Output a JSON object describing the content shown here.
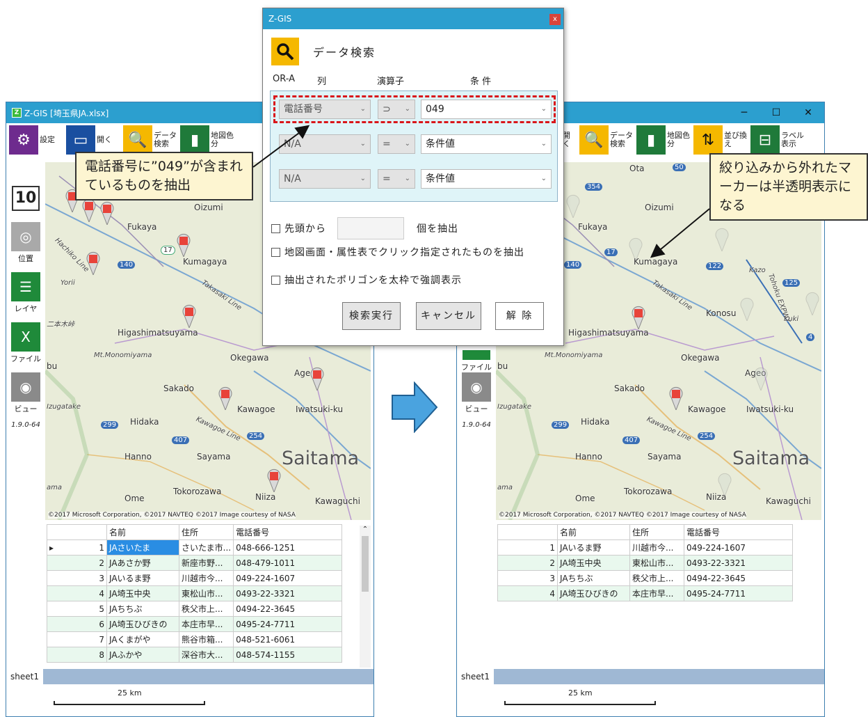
{
  "left_window": {
    "title": "Z-GIS [埼玉県JA.xlsx]",
    "toolbar": [
      {
        "label": "設定",
        "icon": "gear-icon"
      },
      {
        "label": "開く",
        "icon": "folder-icon"
      },
      {
        "label": "データ検索",
        "icon": "search-icon"
      },
      {
        "label": "地図色分",
        "icon": "paint-roller-icon"
      }
    ],
    "sidebar": {
      "zoom": "10",
      "items": [
        "位置",
        "レイヤ",
        "ファイル",
        "ビュー"
      ],
      "version": "1.9.0-64"
    },
    "map": {
      "places": [
        "Oizumi",
        "Fukaya",
        "Kumagaya",
        "Takasaki Line",
        "Yorii",
        "Hachiko Line",
        "Higashimatsuyama",
        "Mt.Monomiyama",
        "Okegawa",
        "Sakado",
        "Ageo",
        "Kawagoe",
        "Iwatsuki-ku",
        "Hidaka",
        "Kawagoe Line",
        "Hanno",
        "Sayama",
        "Saitama",
        "Ome",
        "Tokorozawa",
        "Niiza",
        "Kawaguchi",
        "Izugatake",
        "二本木峠",
        "bu",
        "ama"
      ],
      "roads": [
        "17",
        "140",
        "299",
        "407",
        "254"
      ],
      "credit": "©2017 Microsoft Corporation, ©2017 NAVTEQ ©2017 Image courtesy of NASA"
    },
    "table": {
      "headers": [
        "名前",
        "住所",
        "電話番号"
      ],
      "rows": [
        [
          "1",
          "JAさいたま",
          "さいたま市...",
          "048-666-1251"
        ],
        [
          "2",
          "JAあさか野",
          "新座市野...",
          "048-479-1011"
        ],
        [
          "3",
          "JAいるま野",
          "川越市今...",
          "049-224-1607"
        ],
        [
          "4",
          "JA埼玉中央",
          "東松山市...",
          "0493-22-3321"
        ],
        [
          "5",
          "JAちちぶ",
          "秩父市上...",
          "0494-22-3645"
        ],
        [
          "6",
          "JA埼玉ひびきの",
          "本庄市早...",
          "0495-24-7711"
        ],
        [
          "7",
          "JAくまがや",
          "熊谷市箱...",
          "048-521-6061"
        ],
        [
          "8",
          "JAふかや",
          "深谷市大...",
          "048-574-1155"
        ]
      ]
    },
    "sheet": "sheet1",
    "scale": "25 km"
  },
  "right_window": {
    "toolbar": [
      {
        "label": "開く",
        "icon": "folder-icon"
      },
      {
        "label": "データ検索",
        "icon": "search-icon"
      },
      {
        "label": "地図色分",
        "icon": "paint-roller-icon"
      },
      {
        "label": "並び換え",
        "icon": "sort-icon"
      },
      {
        "label": "ラベル表示",
        "icon": "label-icon"
      }
    ],
    "sidebar": {
      "items": [
        "ファイル",
        "ビュー"
      ],
      "version": "1.9.0-64"
    },
    "map": {
      "places": [
        "Ota",
        "Oizumi",
        "Fukaya",
        "Kumagaya",
        "Takasaki Line",
        "Kazo",
        "Tohoku EXPWY",
        "Konosu",
        "Kuki",
        "Higashimatsuyama",
        "Mt.Monomiyama",
        "Okegawa",
        "Sakado",
        "Ageo",
        "Kawagoe",
        "Iwatsuki-ku",
        "Hidaka",
        "Kawagoe Line",
        "Hanno",
        "Sayama",
        "Saitama",
        "Ome",
        "Tokorozawa",
        "Niiza",
        "Kawaguchi",
        "Izugatake",
        "bu",
        "ama"
      ],
      "roads": [
        "50",
        "354",
        "17",
        "140",
        "122",
        "125",
        "4",
        "299",
        "407",
        "254"
      ],
      "credit": "©2017 Microsoft Corporation, ©2017 NAVTEQ ©2017 Image courtesy of NASA"
    },
    "table": {
      "headers": [
        "名前",
        "住所",
        "電話番号"
      ],
      "rows": [
        [
          "1",
          "JAいるま野",
          "川越市今...",
          "049-224-1607"
        ],
        [
          "2",
          "JA埼玉中央",
          "東松山市...",
          "0493-22-3321"
        ],
        [
          "3",
          "JAちちぶ",
          "秩父市上...",
          "0494-22-3645"
        ],
        [
          "4",
          "JA埼玉ひびきの",
          "本庄市早...",
          "0495-24-7711"
        ]
      ]
    },
    "sheet": "sheet1",
    "scale": "25 km"
  },
  "dialog": {
    "title": "Z-GIS",
    "close": "x",
    "heading": "データ検索",
    "columns": {
      "ora": "OR-A",
      "col": "列",
      "op": "演算子",
      "cond": "条 件"
    },
    "conditions": [
      {
        "column": "電話番号",
        "op": "⊃",
        "value": "049"
      },
      {
        "column": "N/A",
        "op": "=",
        "value": "条件値"
      },
      {
        "column": "N/A",
        "op": "=",
        "value": "条件値"
      }
    ],
    "from_top": "先頭から",
    "from_top_suffix": "個を抽出",
    "option_click": "地図画面・属性表でクリック指定されたものを抽出",
    "option_bold": "抽出されたポリゴンを太枠で強調表示",
    "buttons": {
      "run": "検索実行",
      "cancel": "キャンセル",
      "clear": "解 除"
    }
  },
  "callouts": {
    "left": "電話番号に”049”が含まれているものを抽出",
    "right": "絞り込みから外れたマーカーは半透明表示になる"
  },
  "colors": {
    "accent": "#2c9fcf",
    "pin": "#e8433a",
    "highlight": "#d9161a"
  }
}
